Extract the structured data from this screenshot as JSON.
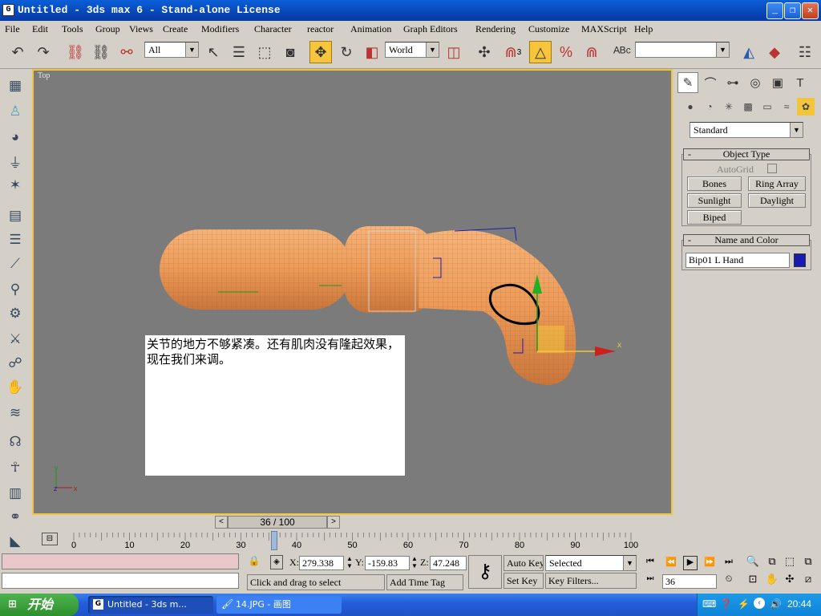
{
  "window": {
    "title": "Untitled - 3ds max 6 - Stand-alone License",
    "icon_letter": "G",
    "controls": [
      "_",
      "❐",
      "✕"
    ]
  },
  "menu": [
    "File",
    "Edit",
    "Tools",
    "Group",
    "Views",
    "Create",
    "Modifiers",
    "Character",
    "reactor",
    "Animation",
    "Graph Editors",
    "Rendering",
    "Customize",
    "MAXScript",
    "Help"
  ],
  "toolbar": {
    "selection_filter": "All",
    "reference_coord": "World",
    "snap_count": "3",
    "named_selection": ""
  },
  "viewport": {
    "label": "Top",
    "note_text": "关节的地方不够紧凑。还有肌肉没有隆起效果，现在我们来调。",
    "gizmo_x": "x",
    "axis_x": "x",
    "axis_y": "y",
    "axis_z": "z"
  },
  "command_panel": {
    "category": "Standard",
    "object_type": {
      "title": "Object Type",
      "autogrid": "AutoGrid",
      "buttons": [
        "Bones",
        "Ring Array",
        "Sunlight",
        "Daylight",
        "Biped"
      ]
    },
    "name_color": {
      "title": "Name and Color",
      "name": "Bip01 L Hand",
      "color": "#1a1ab0"
    }
  },
  "timeline": {
    "frame_display": "36 / 100",
    "current_frame": 36,
    "total_frames": 100,
    "ticks": [
      "0",
      "10",
      "20",
      "30",
      "40",
      "50",
      "60",
      "70",
      "80",
      "90",
      "100"
    ]
  },
  "status": {
    "x_label": "X:",
    "x_value": "279.338",
    "y_label": "Y:",
    "y_value": "-159.83",
    "z_label": "Z:",
    "z_value": "47.248",
    "prompt": "Click and drag to select",
    "add_time_tag": "Add Time Tag",
    "auto_key": "Auto Key",
    "set_key": "Set Key",
    "key_mode": "Selected",
    "key_filters": "Key Filters...",
    "frame_field": "36"
  },
  "taskbar": {
    "start_label": "开始",
    "tasks": [
      "Untitled - 3ds m...",
      "14.JPG - 画图"
    ],
    "clock": "20:44"
  }
}
